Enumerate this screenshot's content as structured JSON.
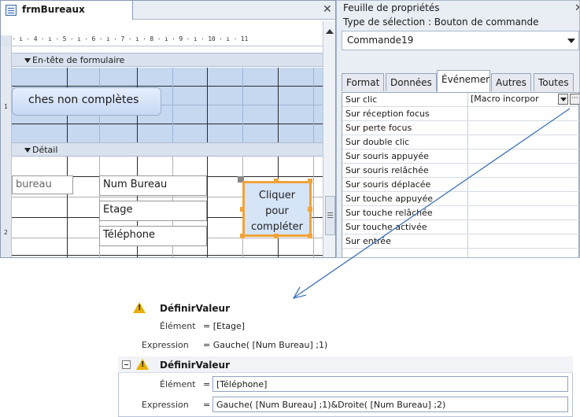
{
  "form_window": {
    "tab_title": "frmBureaux",
    "ruler_text": "· ı · 4 · ı · 5 · ı · 6 · ı · 7 · ı · 8 · ı · 9 · ı · 10 · ı · 11",
    "ruler_left": [
      "1",
      "2"
    ],
    "sections": {
      "header": "En-tête de formulaire",
      "detail": "Détail"
    },
    "header_button_text": "ches non complètes",
    "labels": {
      "bureau_fragment": "bureau",
      "num_bureau": "Num Bureau",
      "etage": "Etage",
      "telephone": "Téléphone"
    },
    "command_button": [
      "Cliquer",
      "pour",
      "compléter"
    ]
  },
  "property_sheet": {
    "title": "Feuille de propriétés",
    "selection_type": "Type de sélection :  Bouton de commande",
    "selected_object": "Commande19",
    "tabs": [
      "Format",
      "Données",
      "Événemen",
      "Autres",
      "Toutes"
    ],
    "active_tab": "Événemen",
    "rows": [
      {
        "name": "Sur clic",
        "value": "[Macro incorpor"
      },
      {
        "name": "Sur réception focus",
        "value": ""
      },
      {
        "name": "Sur perte focus",
        "value": ""
      },
      {
        "name": "Sur double clic",
        "value": ""
      },
      {
        "name": "Sur souris appuyée",
        "value": ""
      },
      {
        "name": "Sur souris relâchée",
        "value": ""
      },
      {
        "name": "Sur souris déplacée",
        "value": ""
      },
      {
        "name": "Sur touche appuyée",
        "value": ""
      },
      {
        "name": "Sur touche relâchée",
        "value": ""
      },
      {
        "name": "Sur touche activée",
        "value": ""
      },
      {
        "name": "Sur entrée",
        "value": ""
      }
    ],
    "builder_glyph": "···"
  },
  "macro_block_1": {
    "action": "DéfinirValeur",
    "element_label": "Élément",
    "element_value": "= [Etage]",
    "expression_label": "Expression",
    "expression_value": "= Gauche( [Num Bureau] ;1)"
  },
  "macro_block_2": {
    "action": "DéfinirValeur",
    "element_label": "Élément",
    "element_eq": "=",
    "element_value": "[Téléphone]",
    "expression_label": "Expression",
    "expression_eq": "=",
    "expression_value": "Gauche( [Num Bureau] ;1)&Droite( [Num Bureau] ;2)"
  },
  "colors": {
    "header_bg": "#c6d8f0",
    "selection_orange": "#f0a33a",
    "warning_yellow": "#e8b000",
    "arrow_blue": "#3f73b8"
  },
  "icons": [
    "form-icon",
    "close-icon",
    "section-arrow-icon",
    "dropdown-icon",
    "builder-icon",
    "warning-icon",
    "collapse-icon"
  ]
}
